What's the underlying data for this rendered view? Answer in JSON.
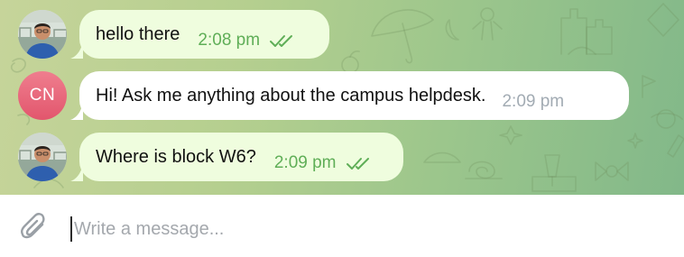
{
  "chat": {
    "messages": [
      {
        "sender": "user",
        "text": "hello there",
        "time": "2:08 pm",
        "status_icon": "double-check-icon"
      },
      {
        "sender": "bot",
        "avatar_initials": "CN",
        "text": "Hi! Ask me anything about the campus helpdesk.",
        "time": "2:09 pm"
      },
      {
        "sender": "user",
        "text": "Where is block W6?",
        "time": "2:09 pm",
        "status_icon": "double-check-icon"
      }
    ]
  },
  "composer": {
    "placeholder": "Write a message...",
    "attach_icon": "paperclip-icon"
  },
  "colors": {
    "outgoing_bubble": "#effdde",
    "incoming_bubble": "#ffffff",
    "outgoing_time": "#5fae57",
    "read_check": "#5fae57",
    "bot_avatar": "#e2566d"
  }
}
